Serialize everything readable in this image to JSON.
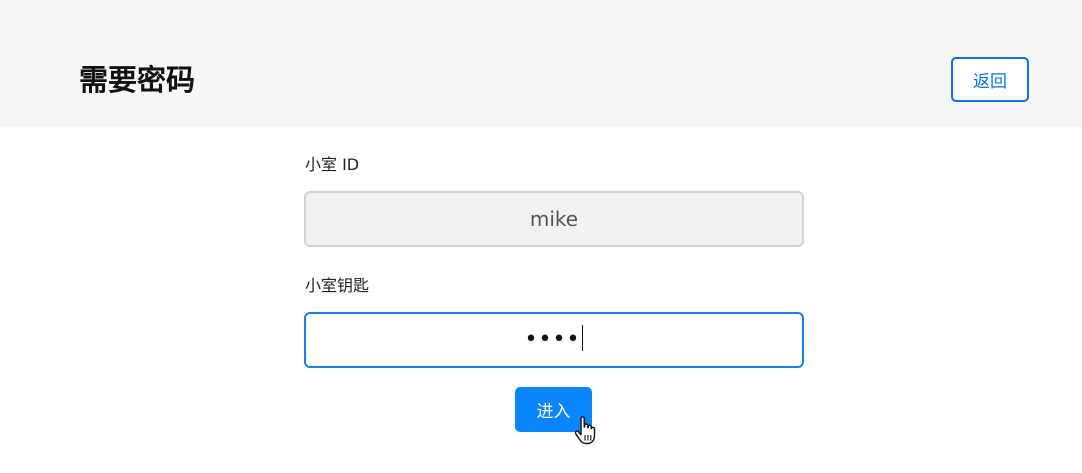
{
  "header": {
    "title": "需要密码",
    "back_label": "返回"
  },
  "form": {
    "room_id": {
      "label": "小室 ID",
      "value": "mike"
    },
    "room_key": {
      "label": "小室钥匙",
      "masked_value": "••••"
    },
    "submit_label": "进入"
  },
  "colors": {
    "accent": "#0a84ff",
    "accent_border": "#1a7fe8",
    "header_bg": "#f7f7f7",
    "disabled_field_bg": "#f2f2f2"
  },
  "icons": {
    "cursor": "hand-pointer-icon"
  }
}
